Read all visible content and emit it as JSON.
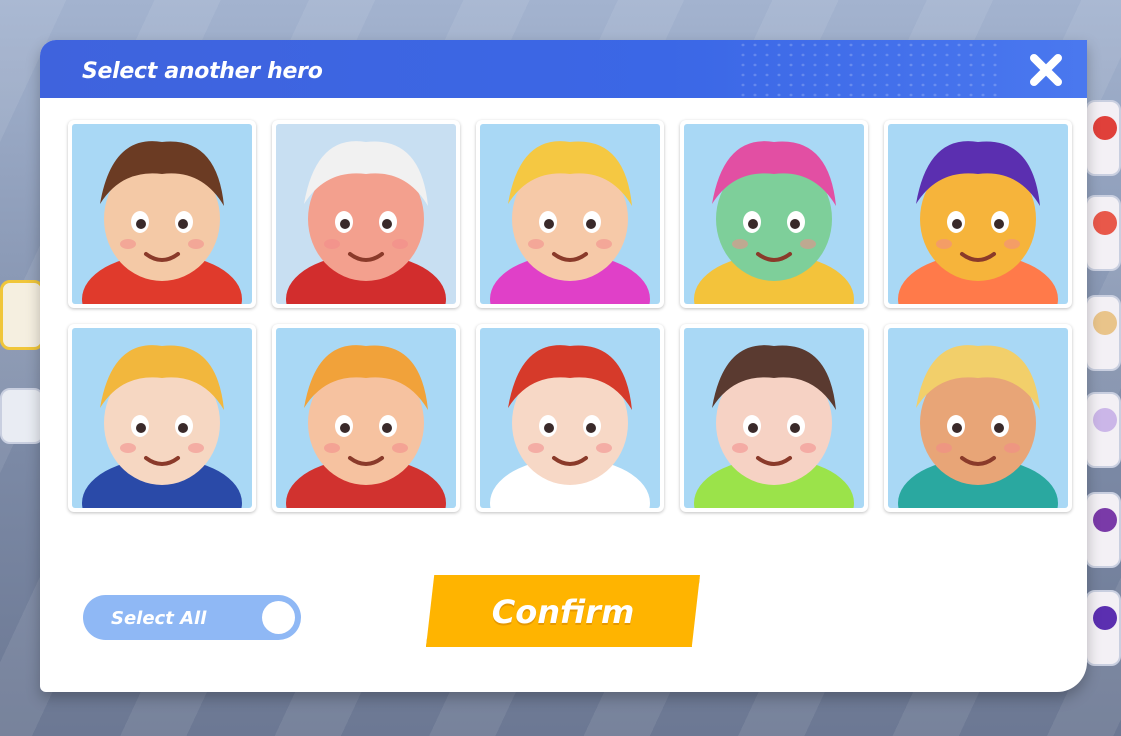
{
  "dialog": {
    "title": "Select another hero",
    "close_icon": "close-icon"
  },
  "heroes": [
    {
      "id": "hero-1",
      "palette": {
        "bg": "#a9d8f5",
        "skin": "#f4c9a6",
        "hair": "#6b3b23",
        "accent": "#e03a2c"
      }
    },
    {
      "id": "hero-2",
      "palette": {
        "bg": "#c8dff2",
        "skin": "#f3a08e",
        "hair": "#f1f1f1",
        "accent": "#d22d2d"
      }
    },
    {
      "id": "hero-3",
      "palette": {
        "bg": "#a9d8f5",
        "skin": "#f6c9a8",
        "hair": "#f5c842",
        "accent": "#e040c8"
      }
    },
    {
      "id": "hero-4",
      "palette": {
        "bg": "#a9d8f5",
        "skin": "#7ecf9a",
        "hair": "#e24fa3",
        "accent": "#f3c33b"
      }
    },
    {
      "id": "hero-5",
      "palette": {
        "bg": "#a9d8f5",
        "skin": "#f6b43b",
        "hair": "#5b2fb0",
        "accent": "#ff7a4a"
      }
    },
    {
      "id": "hero-6",
      "palette": {
        "bg": "#a9d8f5",
        "skin": "#f6d7c2",
        "hair": "#f2b73d",
        "accent": "#2a4aa8"
      }
    },
    {
      "id": "hero-7",
      "palette": {
        "bg": "#a9d8f5",
        "skin": "#f6c2a0",
        "hair": "#f1a23a",
        "accent": "#d1322f"
      }
    },
    {
      "id": "hero-8",
      "palette": {
        "bg": "#a9d8f5",
        "skin": "#f7d8c6",
        "hair": "#d63a2a",
        "accent": "#ffffff"
      }
    },
    {
      "id": "hero-9",
      "palette": {
        "bg": "#a9d8f5",
        "skin": "#f6d2c4",
        "hair": "#5a3a30",
        "accent": "#9be34a"
      }
    },
    {
      "id": "hero-10",
      "palette": {
        "bg": "#a9d8f5",
        "skin": "#e8a577",
        "hair": "#f2cf6a",
        "accent": "#2aa8a0"
      }
    }
  ],
  "controls": {
    "select_all_label": "Select All",
    "confirm_label": "Confirm"
  },
  "colors": {
    "header": "#3f63dd",
    "confirm": "#ffb400",
    "toggle": "#8fb8f5"
  }
}
